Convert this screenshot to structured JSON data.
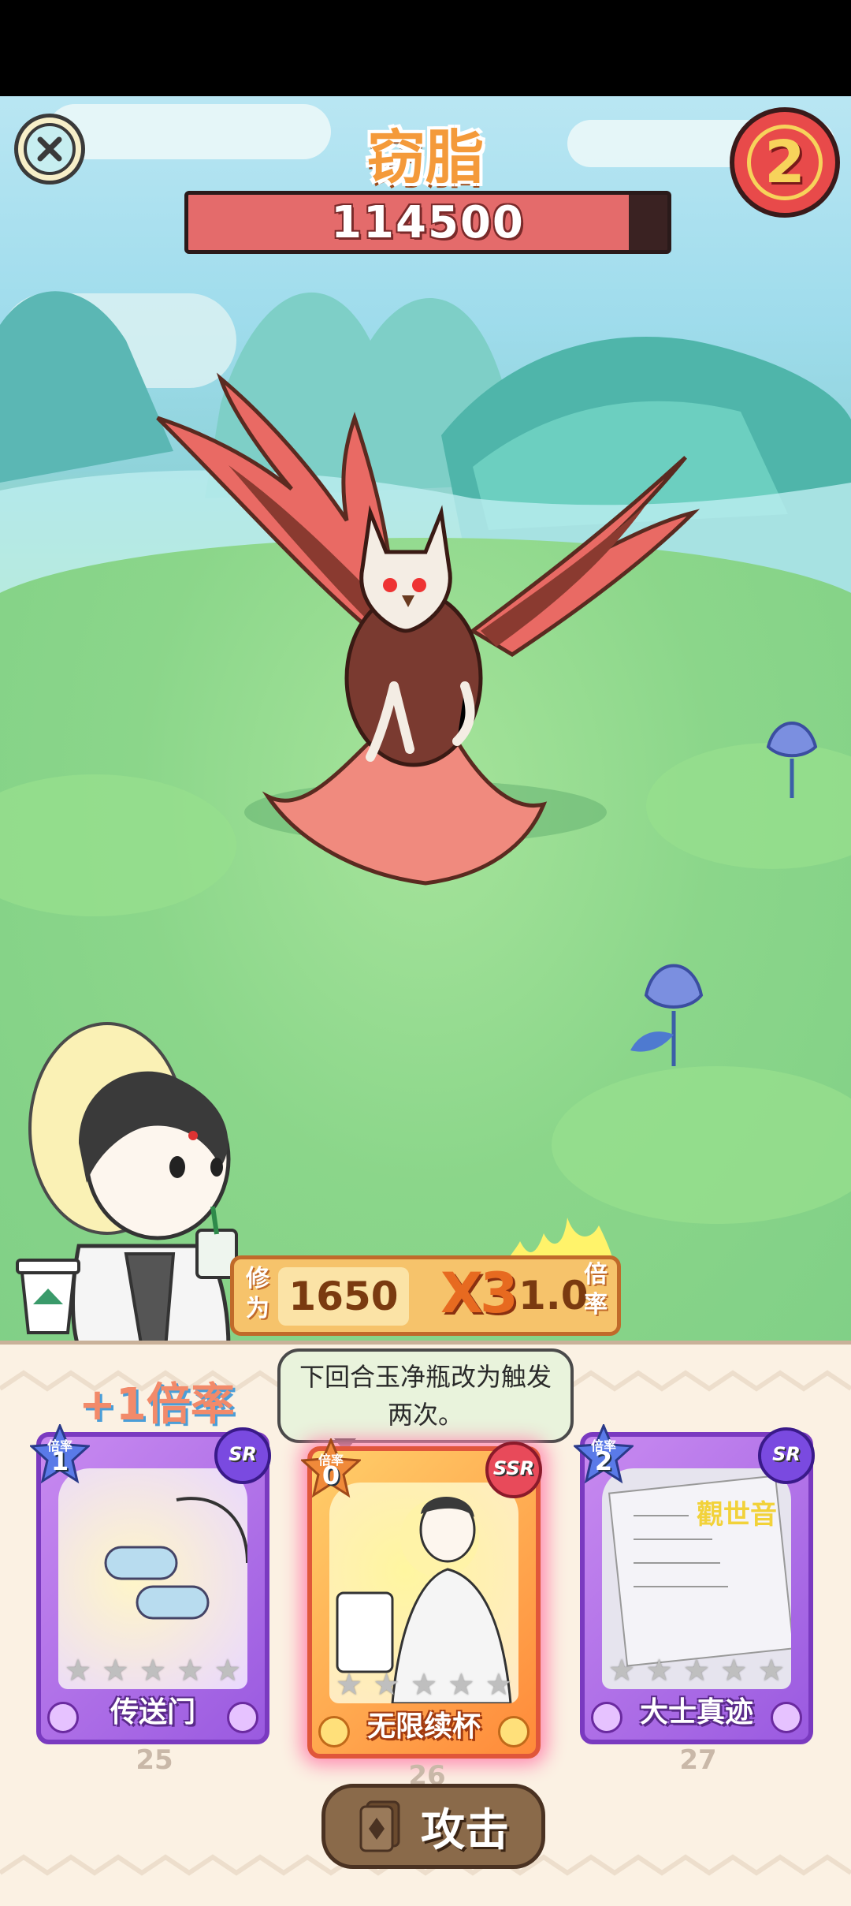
{
  "boss": {
    "name": "窃脂",
    "hp": "114500",
    "hp_fraction": 0.92
  },
  "round": {
    "value": "2"
  },
  "cultivation": {
    "label": "修为",
    "value": "1650",
    "multiplier": "X3",
    "rate_value": "1.0",
    "rate_label": "倍率"
  },
  "bonus_text": "+1倍率",
  "tooltip": "下回合玉净瓶改为触发两次。",
  "cards": [
    {
      "name": "传送门",
      "rate_label": "倍率",
      "rate": "1",
      "rarity": "SR",
      "number": "25",
      "stars": 5
    },
    {
      "name": "无限续杯",
      "rate_label": "倍率",
      "rate": "0",
      "rarity": "SSR",
      "number": "26",
      "stars": 5
    },
    {
      "name": "大士真迹",
      "rate_label": "倍率",
      "rate": "2",
      "rarity": "SR",
      "number": "27",
      "stars": 5
    }
  ],
  "card3_art_text": "觀世音",
  "attack_button": "攻击",
  "icons": {
    "close": "close-x-icon",
    "cup": "cup-icon",
    "attack": "card-icon"
  }
}
